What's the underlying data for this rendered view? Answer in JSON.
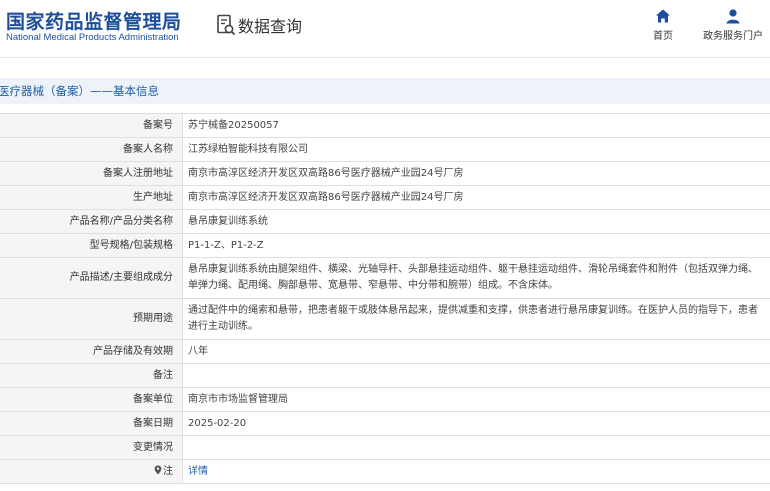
{
  "header": {
    "logo_cn": "国家药品监督管理局",
    "logo_en": "National Medical Products Administration",
    "query_title": "数据查询",
    "nav": {
      "home": "首页",
      "service": "政务服务门户"
    },
    "colors": {
      "brand": "#1d4f9a",
      "link": "#1f5fa8",
      "section_bg": "#eef2f9"
    }
  },
  "section": {
    "title": "医疗器械（备案）——基本信息"
  },
  "rows": [
    {
      "label": "备案号",
      "value": "苏宁械备20250057"
    },
    {
      "label": "备案人名称",
      "value": "江苏绿柏智能科技有限公司"
    },
    {
      "label": "备案人注册地址",
      "value": "南京市高淳区经济开发区双高路86号医疗器械产业园24号厂房"
    },
    {
      "label": "生产地址",
      "value": "南京市高淳区经济开发区双高路86号医疗器械产业园24号厂房"
    },
    {
      "label": "产品名称/产品分类名称",
      "value": "悬吊康复训练系统"
    },
    {
      "label": "型号规格/包装规格",
      "value": "P1-1-Z、P1-2-Z"
    },
    {
      "label": "产品描述/主要组成成分",
      "value": "悬吊康复训练系统由腿架组件、横梁、光轴导杆、头部悬挂运动组件、躯干悬挂运动组件、滑轮吊绳套件和附件（包括双弹力绳、单弹力绳、配用绳、胸部悬带、宽悬带、窄悬带、中分带和腕带）组成。不含床体。"
    },
    {
      "label": "预期用途",
      "value": "通过配件中的绳索和悬带，把患者躯干或肢体悬吊起来，提供减重和支撑，供患者进行悬吊康复训练。在医护人员的指导下，患者进行主动训练。"
    },
    {
      "label": "产品存储及有效期",
      "value": "八年"
    },
    {
      "label": "备注",
      "value": ""
    },
    {
      "label": "备案单位",
      "value": "南京市市场监督管理局"
    },
    {
      "label": "备案日期",
      "value": "2025-02-20"
    },
    {
      "label": "变更情况",
      "value": ""
    },
    {
      "label": "注",
      "value": "详情"
    }
  ]
}
